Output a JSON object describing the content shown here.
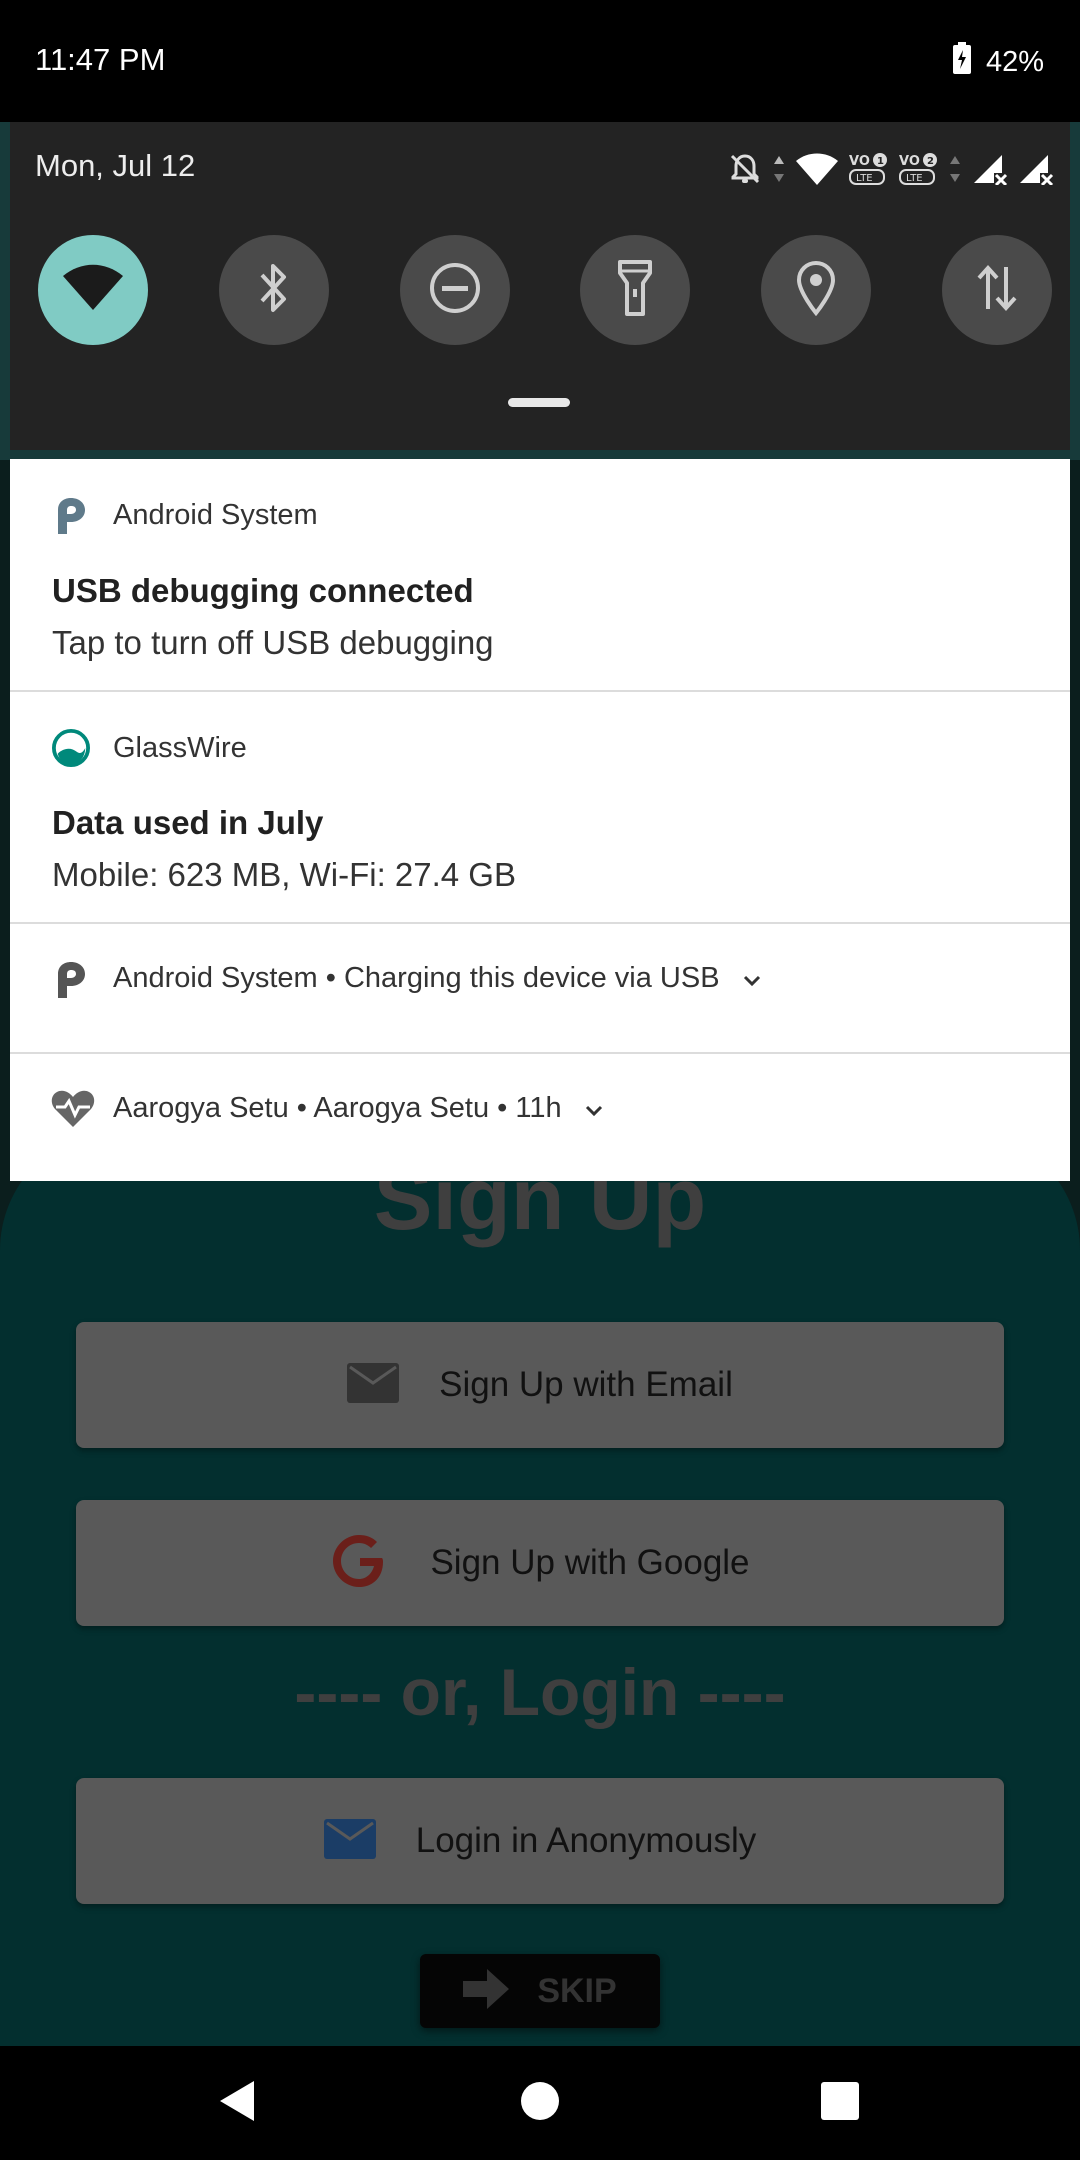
{
  "status_bar": {
    "time": "11:47 PM",
    "battery": "42%"
  },
  "quick_settings": {
    "date": "Mon, Jul 12",
    "tiles": [
      {
        "name": "wifi",
        "on": true
      },
      {
        "name": "bluetooth",
        "on": false
      },
      {
        "name": "do-not-disturb",
        "on": false
      },
      {
        "name": "flashlight",
        "on": false
      },
      {
        "name": "location",
        "on": false
      },
      {
        "name": "mobile-data",
        "on": false
      }
    ],
    "status_icons": [
      "bell-off-icon",
      "data-arrows-icon",
      "wifi-icon",
      "volte1-icon",
      "volte2-icon",
      "data-arrows-icon",
      "signal-x-icon",
      "signal-x-icon"
    ]
  },
  "notifications": [
    {
      "app": "Android System",
      "title": "USB debugging connected",
      "text": "Tap to turn off USB debugging"
    },
    {
      "app": "GlassWire",
      "title": "Data used in July",
      "text": "Mobile: 623 MB, Wi-Fi: 27.4 GB"
    },
    {
      "summary": "Android System • Charging this device via USB"
    },
    {
      "summary": "Aarogya Setu • Aarogya Setu • 11h"
    }
  ],
  "app": {
    "title": "Sign Up",
    "email_button": "Sign Up with Email",
    "google_button": "Sign Up with Google",
    "or_login": "---- or, Login ----",
    "anon_button": "Login in Anonymously",
    "skip_button": "SKIP"
  },
  "colors": {
    "accent_tile": "#80cbc4",
    "panel_bg": "#232323",
    "app_bg": "#032f2f"
  }
}
